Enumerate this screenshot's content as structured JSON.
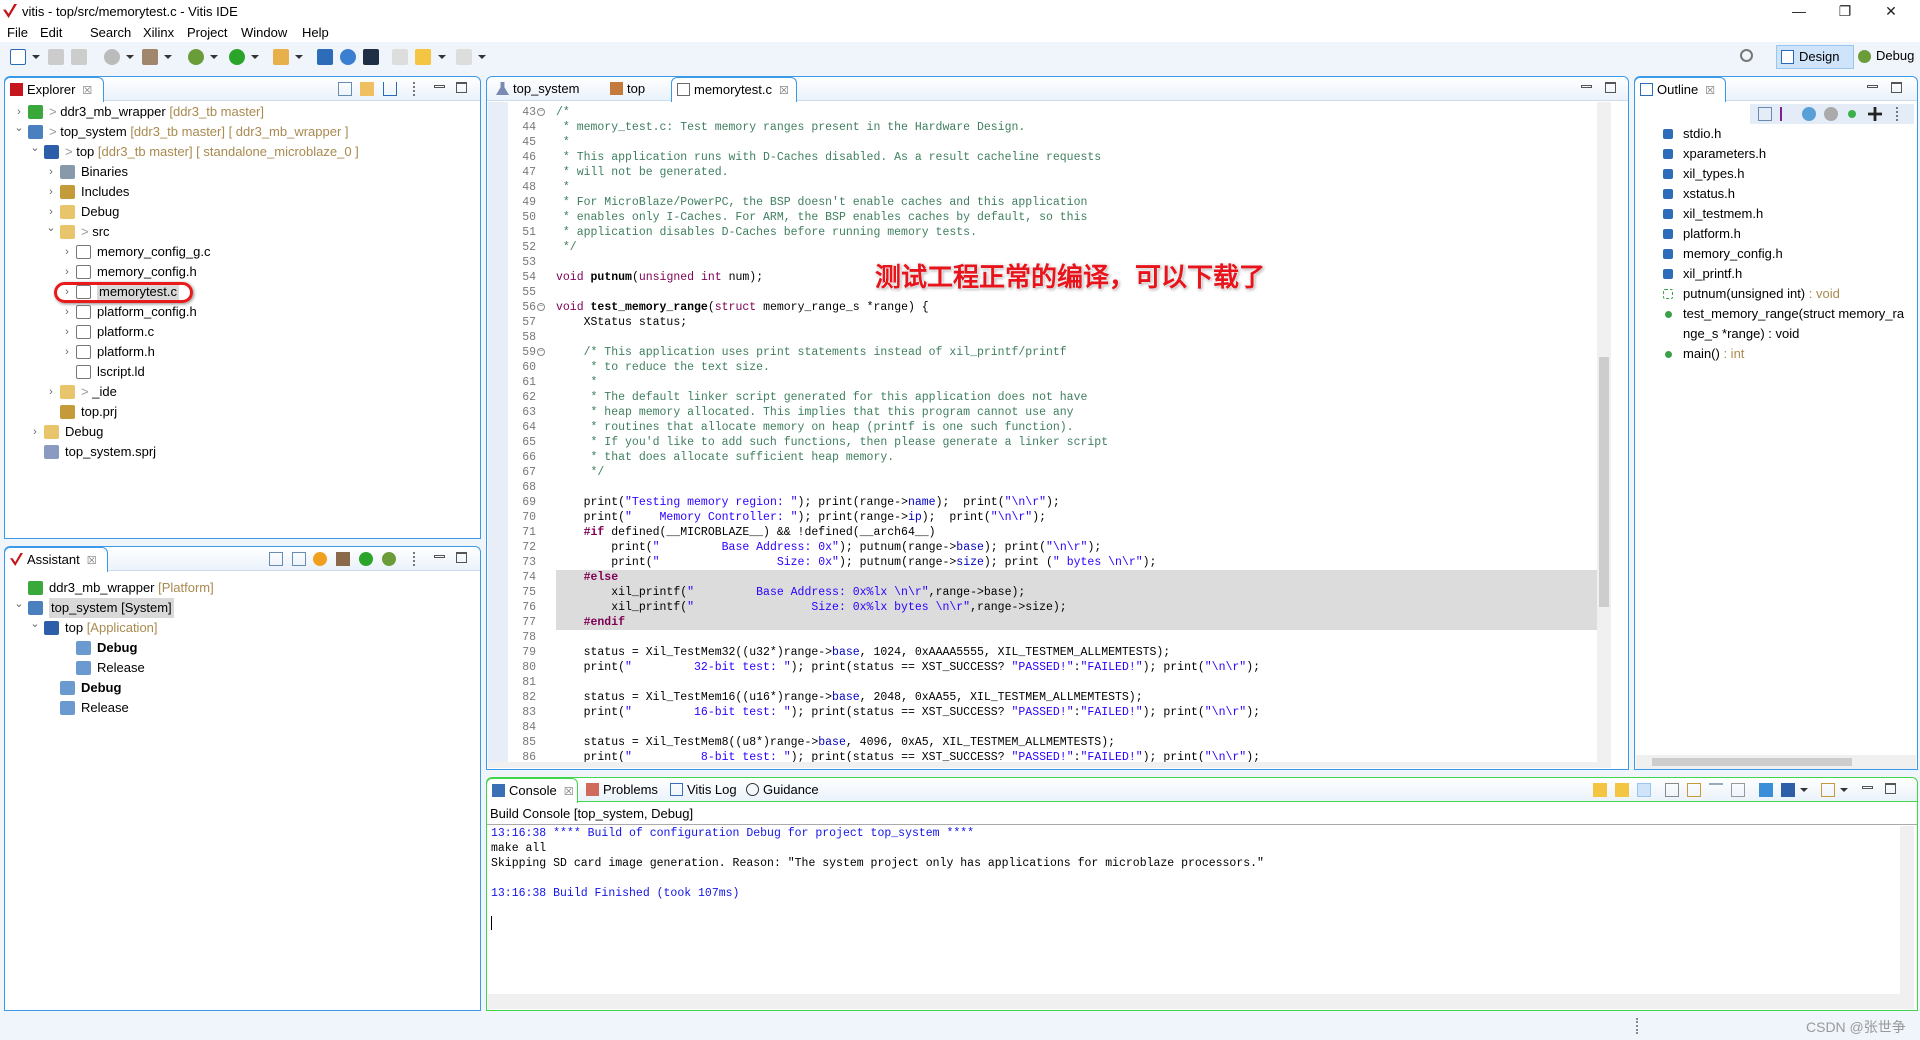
{
  "window": {
    "title": "vitis - top/src/memorytest.c - Vitis IDE",
    "minimize": "—",
    "restore": "❐",
    "close": "✕"
  },
  "menu": [
    "File",
    "Edit",
    "Search",
    "Xilinx",
    "Project",
    "Window",
    "Help"
  ],
  "perspectives": {
    "design": "Design",
    "debug": "Debug"
  },
  "colors": {
    "accent": "#3b99e8",
    "console_border": "#3fd64a",
    "comment": "#3f7f5f",
    "keyword": "#7f0055",
    "string": "#2a00ff",
    "field": "#0000c0",
    "annotation": "#e8141c"
  },
  "explorer": {
    "tab": "Explorer",
    "close": "☒",
    "items": [
      {
        "d": 0,
        "ch": ">",
        "icon": "platform",
        "deco": "> ",
        "label": "ddr3_mb_wrapper",
        "sfx": "[ddr3_tb master]"
      },
      {
        "d": 0,
        "ch": "v",
        "icon": "system",
        "deco": "> ",
        "label": "top_system",
        "sfx": "[ddr3_tb master] [ ddr3_mb_wrapper ]"
      },
      {
        "d": 1,
        "ch": "v",
        "icon": "app",
        "deco": "> ",
        "label": "top",
        "sfx": "[ddr3_tb master] [ standalone_microblaze_0 ]"
      },
      {
        "d": 2,
        "ch": ">",
        "icon": "binaries",
        "label": "Binaries"
      },
      {
        "d": 2,
        "ch": ">",
        "icon": "includes",
        "label": "Includes"
      },
      {
        "d": 2,
        "ch": ">",
        "icon": "folder",
        "label": "Debug"
      },
      {
        "d": 2,
        "ch": "v",
        "icon": "folder",
        "deco": "> ",
        "label": "src"
      },
      {
        "d": 3,
        "ch": ">",
        "icon": "cfile",
        "label": "memory_config_g.c"
      },
      {
        "d": 3,
        "ch": ">",
        "icon": "hfile",
        "label": "memory_config.h"
      },
      {
        "d": 3,
        "ch": ">",
        "icon": "cfile",
        "label": "memorytest.c",
        "sel": true
      },
      {
        "d": 3,
        "ch": ">",
        "icon": "hfile",
        "label": "platform_config.h"
      },
      {
        "d": 3,
        "ch": ">",
        "icon": "cfile",
        "label": "platform.c"
      },
      {
        "d": 3,
        "ch": ">",
        "icon": "hfile",
        "label": "platform.h"
      },
      {
        "d": 3,
        "ch": "",
        "icon": "ldfile",
        "label": "lscript.ld"
      },
      {
        "d": 2,
        "ch": ">",
        "icon": "folder",
        "deco": "> ",
        "label": "_ide"
      },
      {
        "d": 2,
        "ch": "",
        "icon": "prj",
        "label": "top.prj"
      },
      {
        "d": 1,
        "ch": ">",
        "icon": "folder",
        "label": "Debug"
      },
      {
        "d": 1,
        "ch": "",
        "icon": "sprj",
        "label": "top_system.sprj"
      }
    ]
  },
  "assistant": {
    "tab": "Assistant",
    "close": "☒",
    "items": [
      {
        "d": 0,
        "ch": "",
        "icon": "platform",
        "label": "ddr3_mb_wrapper",
        "sfx": "[Platform]"
      },
      {
        "d": 0,
        "ch": "v",
        "icon": "system",
        "label": "top_system [System]",
        "sel": true
      },
      {
        "d": 1,
        "ch": "v",
        "icon": "app",
        "label": "top",
        "sfx": "[Application]"
      },
      {
        "d": 3,
        "ch": "",
        "icon": "hammer-check",
        "label": "Debug",
        "bold": true
      },
      {
        "d": 3,
        "ch": "",
        "icon": "hammer",
        "label": "Release"
      },
      {
        "d": 2,
        "ch": "",
        "icon": "hammer-check",
        "label": "Debug",
        "bold": true
      },
      {
        "d": 2,
        "ch": "",
        "icon": "hammer",
        "label": "Release"
      }
    ]
  },
  "editor": {
    "tabs": [
      {
        "label": "top_system",
        "icon": "flask"
      },
      {
        "label": "top",
        "icon": "tools"
      },
      {
        "label": "memorytest.c",
        "icon": "cfile",
        "active": true,
        "close": "☒"
      }
    ],
    "lines": [
      {
        "n": 43,
        "fold": true,
        "seg": [
          [
            "c",
            "/*"
          ]
        ]
      },
      {
        "n": 44,
        "seg": [
          [
            "c",
            " * memory_test.c: Test memory ranges present in the Hardware Design."
          ]
        ]
      },
      {
        "n": 45,
        "seg": [
          [
            "c",
            " *"
          ]
        ]
      },
      {
        "n": 46,
        "seg": [
          [
            "c",
            " * This application runs with D-Caches disabled. As a result cacheline requests"
          ]
        ]
      },
      {
        "n": 47,
        "seg": [
          [
            "c",
            " * will not be generated."
          ]
        ]
      },
      {
        "n": 48,
        "seg": [
          [
            "c",
            " *"
          ]
        ]
      },
      {
        "n": 49,
        "seg": [
          [
            "c",
            " * For MicroBlaze/PowerPC, the BSP doesn't enable caches and this application"
          ]
        ]
      },
      {
        "n": 50,
        "seg": [
          [
            "c",
            " * enables only I-Caches. For ARM, the BSP enables caches by default, so this"
          ]
        ]
      },
      {
        "n": 51,
        "seg": [
          [
            "c",
            " * application disables D-Caches before running memory tests."
          ]
        ]
      },
      {
        "n": 52,
        "seg": [
          [
            "c",
            " */"
          ]
        ]
      },
      {
        "n": 53,
        "seg": []
      },
      {
        "n": 54,
        "seg": [
          [
            "k",
            "void"
          ],
          [
            "n",
            " "
          ],
          [
            "b",
            "putnum"
          ],
          [
            "n",
            "("
          ],
          [
            "k",
            "unsigned"
          ],
          [
            "n",
            " "
          ],
          [
            "k",
            "int"
          ],
          [
            "n",
            " num);"
          ]
        ]
      },
      {
        "n": 55,
        "seg": []
      },
      {
        "n": 56,
        "fold": true,
        "seg": [
          [
            "k",
            "void"
          ],
          [
            "n",
            " "
          ],
          [
            "b",
            "test_memory_range"
          ],
          [
            "n",
            "("
          ],
          [
            "k",
            "struct"
          ],
          [
            "n",
            " memory_range_s *range) {"
          ]
        ]
      },
      {
        "n": 57,
        "seg": [
          [
            "n",
            "    XStatus status;"
          ]
        ]
      },
      {
        "n": 58,
        "seg": []
      },
      {
        "n": 59,
        "fold": true,
        "seg": [
          [
            "c",
            "    /* This application uses print statements instead of xil_printf/printf"
          ]
        ]
      },
      {
        "n": 60,
        "seg": [
          [
            "c",
            "     * to reduce the text size."
          ]
        ]
      },
      {
        "n": 61,
        "seg": [
          [
            "c",
            "     *"
          ]
        ]
      },
      {
        "n": 62,
        "seg": [
          [
            "c",
            "     * The default linker script generated for this application does not have"
          ]
        ]
      },
      {
        "n": 63,
        "seg": [
          [
            "c",
            "     * heap memory allocated. This implies that this program cannot use any"
          ]
        ]
      },
      {
        "n": 64,
        "seg": [
          [
            "c",
            "     * routines that allocate memory on heap (printf is one such function)."
          ]
        ]
      },
      {
        "n": 65,
        "seg": [
          [
            "c",
            "     * If you'd like to add such functions, then please generate a linker script"
          ]
        ]
      },
      {
        "n": 66,
        "seg": [
          [
            "c",
            "     * that does allocate sufficient heap memory."
          ]
        ]
      },
      {
        "n": 67,
        "seg": [
          [
            "c",
            "     */"
          ]
        ]
      },
      {
        "n": 68,
        "seg": []
      },
      {
        "n": 69,
        "seg": [
          [
            "n",
            "    print("
          ],
          [
            "s",
            "\"Testing memory region: \""
          ],
          [
            "n",
            "); print(range->"
          ],
          [
            "f",
            "name"
          ],
          [
            "n",
            ");  print("
          ],
          [
            "s",
            "\"\\n\\r\""
          ],
          [
            "n",
            ");"
          ]
        ]
      },
      {
        "n": 70,
        "seg": [
          [
            "n",
            "    print("
          ],
          [
            "s",
            "\"    Memory Controller: \""
          ],
          [
            "n",
            "); print(range->"
          ],
          [
            "f",
            "ip"
          ],
          [
            "n",
            ");  print("
          ],
          [
            "s",
            "\"\\n\\r\""
          ],
          [
            "n",
            ");"
          ]
        ]
      },
      {
        "n": 71,
        "seg": [
          [
            "p",
            "    #if"
          ],
          [
            "n",
            " defined(__MICROBLAZE__) && !defined(__arch64__)"
          ]
        ]
      },
      {
        "n": 72,
        "seg": [
          [
            "n",
            "        print("
          ],
          [
            "s",
            "\"         Base Address: 0x\""
          ],
          [
            "n",
            "); putnum(range->"
          ],
          [
            "f",
            "base"
          ],
          [
            "n",
            "); print("
          ],
          [
            "s",
            "\"\\n\\r\""
          ],
          [
            "n",
            ");"
          ]
        ]
      },
      {
        "n": 73,
        "seg": [
          [
            "n",
            "        print("
          ],
          [
            "s",
            "\"                 Size: 0x\""
          ],
          [
            "n",
            "); putnum(range->"
          ],
          [
            "f",
            "size"
          ],
          [
            "n",
            "); print ("
          ],
          [
            "s",
            "\" bytes \\n\\r\""
          ],
          [
            "n",
            ");"
          ]
        ]
      },
      {
        "n": 74,
        "hl": true,
        "seg": [
          [
            "p",
            "    #else"
          ]
        ]
      },
      {
        "n": 75,
        "hl": true,
        "seg": [
          [
            "n",
            "        xil_printf("
          ],
          [
            "s",
            "\"         Base Address: 0x%lx \\n\\r\""
          ],
          [
            "n",
            ",range->base);"
          ]
        ]
      },
      {
        "n": 76,
        "hl": true,
        "seg": [
          [
            "n",
            "        xil_printf("
          ],
          [
            "s",
            "\"                 Size: 0x%lx bytes \\n\\r\""
          ],
          [
            "n",
            ",range->size);"
          ]
        ]
      },
      {
        "n": 77,
        "hl": true,
        "seg": [
          [
            "p",
            "    #endif"
          ]
        ]
      },
      {
        "n": 78,
        "seg": []
      },
      {
        "n": 79,
        "seg": [
          [
            "n",
            "    status = Xil_TestMem32((u32*)range->"
          ],
          [
            "f",
            "base"
          ],
          [
            "n",
            ", 1024, 0xAAAA5555, XIL_TESTMEM_ALLMEMTESTS);"
          ]
        ]
      },
      {
        "n": 80,
        "seg": [
          [
            "n",
            "    print("
          ],
          [
            "s",
            "\"         32-bit test: \""
          ],
          [
            "n",
            "); print(status == XST_SUCCESS? "
          ],
          [
            "s",
            "\"PASSED!\""
          ],
          [
            "n",
            ":"
          ],
          [
            "s",
            "\"FAILED!\""
          ],
          [
            "n",
            "); print("
          ],
          [
            "s",
            "\"\\n\\r\""
          ],
          [
            "n",
            ");"
          ]
        ]
      },
      {
        "n": 81,
        "seg": []
      },
      {
        "n": 82,
        "seg": [
          [
            "n",
            "    status = Xil_TestMem16((u16*)range->"
          ],
          [
            "f",
            "base"
          ],
          [
            "n",
            ", 2048, 0xAA55, XIL_TESTMEM_ALLMEMTESTS);"
          ]
        ]
      },
      {
        "n": 83,
        "seg": [
          [
            "n",
            "    print("
          ],
          [
            "s",
            "\"         16-bit test: \""
          ],
          [
            "n",
            "); print(status == XST_SUCCESS? "
          ],
          [
            "s",
            "\"PASSED!\""
          ],
          [
            "n",
            ":"
          ],
          [
            "s",
            "\"FAILED!\""
          ],
          [
            "n",
            "); print("
          ],
          [
            "s",
            "\"\\n\\r\""
          ],
          [
            "n",
            ");"
          ]
        ]
      },
      {
        "n": 84,
        "seg": []
      },
      {
        "n": 85,
        "seg": [
          [
            "n",
            "    status = Xil_TestMem8((u8*)range->"
          ],
          [
            "f",
            "base"
          ],
          [
            "n",
            ", 4096, 0xA5, XIL_TESTMEM_ALLMEMTESTS);"
          ]
        ]
      },
      {
        "n": 86,
        "seg": [
          [
            "n",
            "    print("
          ],
          [
            "s",
            "\"          8-bit test: \""
          ],
          [
            "n",
            "); print(status == XST_SUCCESS? "
          ],
          [
            "s",
            "\"PASSED!\""
          ],
          [
            "n",
            ":"
          ],
          [
            "s",
            "\"FAILED!\""
          ],
          [
            "n",
            "); print("
          ],
          [
            "s",
            "\"\\n\\r\""
          ],
          [
            "n",
            ");"
          ]
        ]
      }
    ]
  },
  "annotation": "测试工程正常的编译，可以下载了",
  "outline": {
    "tab": "Outline",
    "close": "☒",
    "items": [
      {
        "icon": "include",
        "label": "stdio.h"
      },
      {
        "icon": "include",
        "label": "xparameters.h"
      },
      {
        "icon": "include",
        "label": "xil_types.h"
      },
      {
        "icon": "include",
        "label": "xstatus.h"
      },
      {
        "icon": "include",
        "label": "xil_testmem.h"
      },
      {
        "icon": "include",
        "label": "platform.h"
      },
      {
        "icon": "include",
        "label": "memory_config.h"
      },
      {
        "icon": "include",
        "label": "xil_printf.h"
      },
      {
        "icon": "declaration",
        "label": "putnum(unsigned int)",
        "sfx": " : void"
      },
      {
        "icon": "function",
        "label": "test_memory_range(struct memory_range_s *range) : void"
      },
      {
        "icon": "function",
        "label": "main()",
        "sfx": " : int"
      }
    ]
  },
  "console": {
    "tabs": [
      {
        "label": "Console",
        "icon": "console",
        "close": "☒"
      },
      {
        "label": "Problems",
        "icon": "problems"
      },
      {
        "label": "Vitis Log",
        "icon": "log"
      },
      {
        "label": "Guidance",
        "icon": "info"
      }
    ],
    "header": "Build Console [top_system, Debug]",
    "lines": [
      {
        "t": "13:16:38 **** Build of configuration Debug for project top_system ****",
        "blue": true
      },
      {
        "t": "make all"
      },
      {
        "t": "Skipping SD card image generation. Reason: \"The system project only has applications for microblaze processors.\""
      },
      {
        "t": ""
      },
      {
        "t": "13:16:38 Build Finished (took 107ms)",
        "blue": true
      }
    ]
  },
  "watermark": "CSDN @张世争"
}
